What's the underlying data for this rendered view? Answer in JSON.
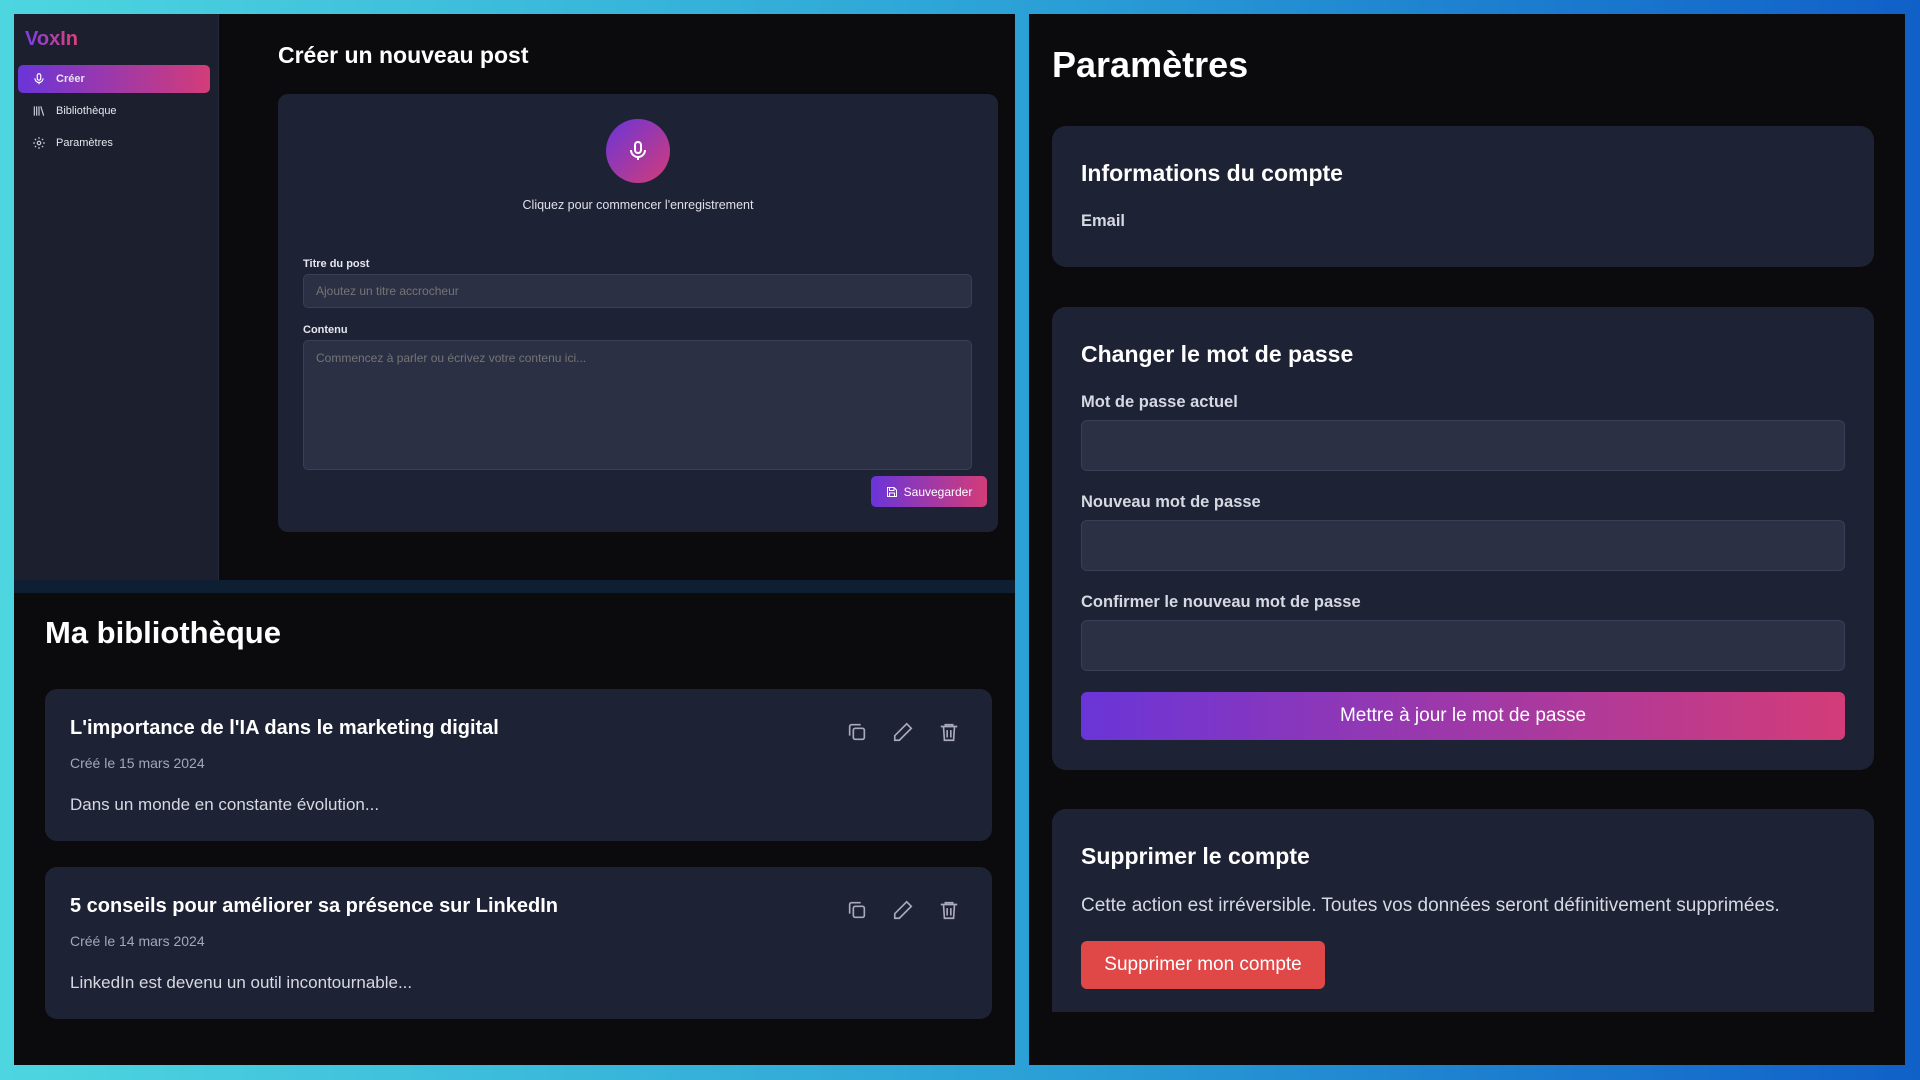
{
  "brand": "VoxIn",
  "sidebar": {
    "items": [
      {
        "label": "Créer",
        "icon": "mic-icon"
      },
      {
        "label": "Bibliothèque",
        "icon": "library-icon"
      },
      {
        "label": "Paramètres",
        "icon": "gear-icon"
      }
    ]
  },
  "create": {
    "title": "Créer un nouveau post",
    "record_hint": "Cliquez pour commencer l'enregistrement",
    "post_title_label": "Titre du post",
    "post_title_placeholder": "Ajoutez un titre accrocheur",
    "content_label": "Contenu",
    "content_placeholder": "Commencez à parler ou écrivez votre contenu ici...",
    "save_label": "Sauvegarder"
  },
  "library": {
    "title": "Ma bibliothèque",
    "posts": [
      {
        "title": "L'importance de l'IA dans le marketing digital",
        "date": "Créé le 15 mars 2024",
        "excerpt": "Dans un monde en constante évolution..."
      },
      {
        "title": "5 conseils pour améliorer sa présence sur LinkedIn",
        "date": "Créé le 14 mars 2024",
        "excerpt": "LinkedIn est devenu un outil incontournable..."
      }
    ]
  },
  "settings": {
    "title": "Paramètres",
    "account": {
      "title": "Informations du compte",
      "email_label": "Email"
    },
    "password": {
      "title": "Changer le mot de passe",
      "current_label": "Mot de passe actuel",
      "new_label": "Nouveau mot de passe",
      "confirm_label": "Confirmer le nouveau mot de passe",
      "update_label": "Mettre à jour le mot de passe"
    },
    "delete": {
      "title": "Supprimer le compte",
      "warning": "Cette action est irréversible. Toutes vos données seront définitivement supprimées.",
      "button_label": "Supprimer mon compte"
    }
  },
  "colors": {
    "accent_start": "#6a35d8",
    "accent_end": "#d33c78",
    "danger": "#e04848",
    "card_bg": "#1e2235"
  }
}
